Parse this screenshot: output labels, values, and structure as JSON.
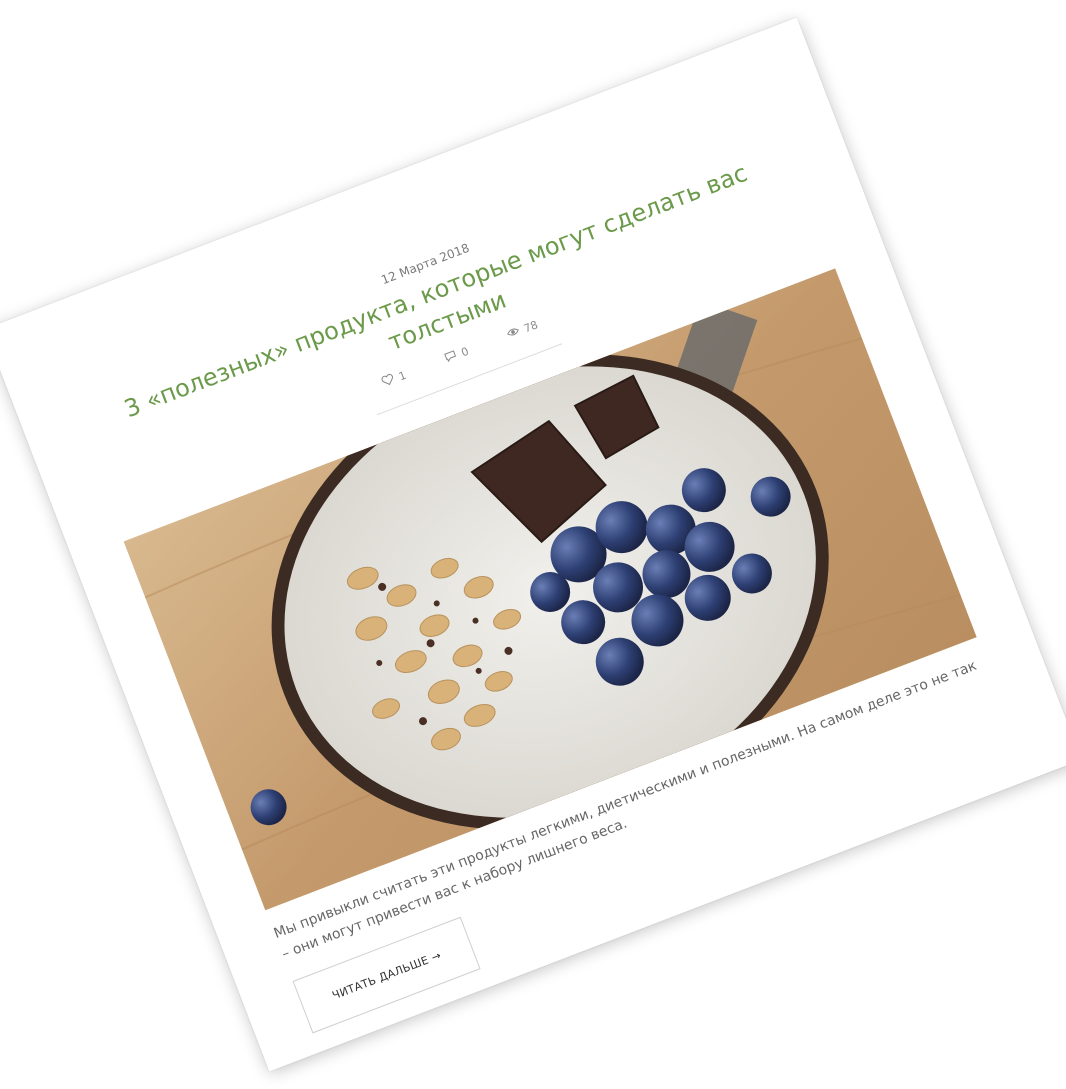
{
  "post": {
    "date": "12 Марта 2018",
    "title": "3 «полезных» продукта, которые могут сделать вас толстыми",
    "stats": {
      "likes": "1",
      "comments": "0",
      "views": "78"
    },
    "excerpt": "Мы привыкли считать эти продукты легкими, диетическими и полезными. На самом деле это не так – они могут привести вас к набору лишнего веса.",
    "read_more": "ЧИТАТЬ ДАЛЬШЕ →"
  },
  "colors": {
    "title": "#6b9a4a",
    "text": "#666666",
    "meta": "#7a7a7a"
  },
  "icons": [
    "heart-icon",
    "comment-icon",
    "eye-icon",
    "arrow-right-icon"
  ]
}
